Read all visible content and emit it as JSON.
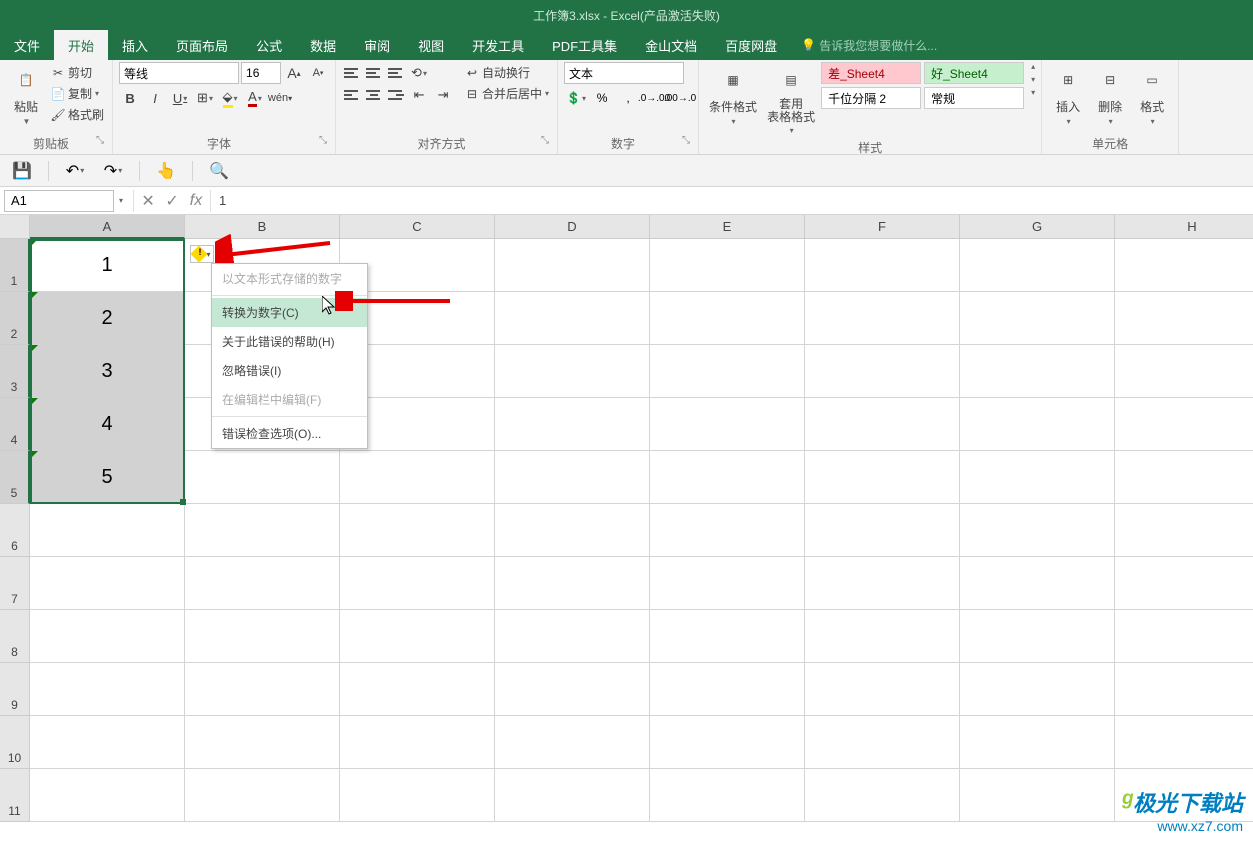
{
  "title": "工作簿3.xlsx - Excel(产品激活失败)",
  "menu": {
    "file": "文件",
    "home": "开始",
    "insert": "插入",
    "layout": "页面布局",
    "formulas": "公式",
    "data": "数据",
    "review": "审阅",
    "view": "视图",
    "dev": "开发工具",
    "pdf": "PDF工具集",
    "kingsoft": "金山文档",
    "baidu": "百度网盘",
    "tellme": "告诉我您想要做什么..."
  },
  "ribbon": {
    "clipboard": {
      "label": "剪贴板",
      "paste": "粘贴",
      "cut": "剪切",
      "copy": "复制",
      "painter": "格式刷"
    },
    "font": {
      "label": "字体",
      "name": "等线",
      "size": "16"
    },
    "align": {
      "label": "对齐方式",
      "wrap": "自动换行",
      "merge": "合并后居中"
    },
    "number": {
      "label": "数字",
      "format": "文本"
    },
    "styles": {
      "label": "样式",
      "cond": "条件格式",
      "table": "套用\n表格格式",
      "bad": "差_Sheet4",
      "good": "好_Sheet4",
      "comma": "千位分隔 2",
      "normal": "常规"
    },
    "cells": {
      "label": "单元格",
      "insert": "插入",
      "delete": "删除",
      "format": "格式"
    }
  },
  "namebox": "A1",
  "formula_value": "1",
  "columns": [
    "A",
    "B",
    "C",
    "D",
    "E",
    "F",
    "G",
    "H"
  ],
  "rows": [
    "1",
    "2",
    "3",
    "4",
    "5",
    "6",
    "7",
    "8",
    "9",
    "10",
    "11"
  ],
  "cell_data": [
    "1",
    "2",
    "3",
    "4",
    "5"
  ],
  "menu_items": {
    "stored_as_text": "以文本形式存储的数字",
    "convert": "转换为数字(C)",
    "help": "关于此错误的帮助(H)",
    "ignore": "忽略错误(I)",
    "edit": "在编辑栏中编辑(F)",
    "options": "错误检查选项(O)..."
  },
  "watermark": {
    "brand": "极光下载站",
    "url": "www.xz7.com"
  }
}
